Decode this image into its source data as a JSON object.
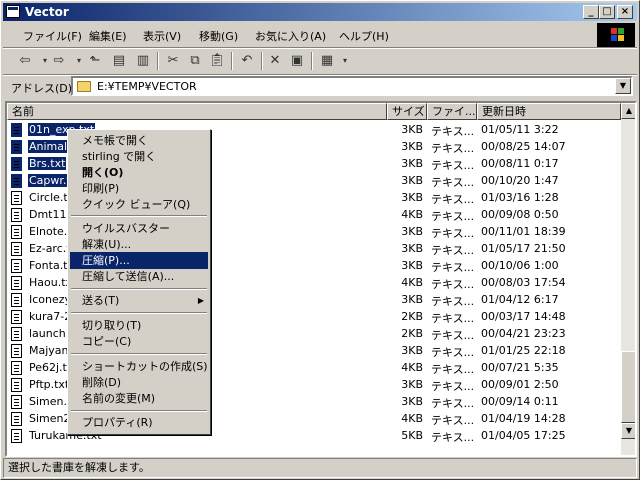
{
  "window": {
    "title": "Vector"
  },
  "menubar": [
    {
      "label": "ファイル(F)"
    },
    {
      "label": "編集(E)"
    },
    {
      "label": "表示(V)"
    },
    {
      "label": "移動(G)"
    },
    {
      "label": "お気に入り(A)"
    },
    {
      "label": "ヘルプ(H)"
    }
  ],
  "address": {
    "label": "アドレス(D)",
    "value": "E:¥TEMP¥VECTOR"
  },
  "columns": {
    "name": "名前",
    "size": "サイズ",
    "type": "ファイ...",
    "date": "更新日時"
  },
  "files": [
    {
      "name": "01n_exp.txt",
      "size": "3KB",
      "type": "テキス...",
      "date": "01/05/11 3:22",
      "selected": true
    },
    {
      "name": "Animal.txt",
      "size": "3KB",
      "type": "テキス...",
      "date": "00/08/25 14:07",
      "selected": true
    },
    {
      "name": "Brs.txt",
      "size": "3KB",
      "type": "テキス...",
      "date": "00/08/11 0:17",
      "selected": true
    },
    {
      "name": "Capwr.txt",
      "size": "3KB",
      "type": "テキス...",
      "date": "00/10/20 1:47",
      "selected": true
    },
    {
      "name": "Circle.txt",
      "size": "3KB",
      "type": "テキス...",
      "date": "01/03/16 1:28",
      "selected": false
    },
    {
      "name": "Dmt116.txt",
      "size": "4KB",
      "type": "テキス...",
      "date": "00/09/08 0:50",
      "selected": false
    },
    {
      "name": "Elnote.txt",
      "size": "3KB",
      "type": "テキス...",
      "date": "00/11/01 18:39",
      "selected": false
    },
    {
      "name": "Ez-arc.txt",
      "size": "3KB",
      "type": "テキス...",
      "date": "01/05/17 21:50",
      "selected": false
    },
    {
      "name": "Fonta.txt",
      "size": "3KB",
      "type": "テキス...",
      "date": "00/10/06 1:00",
      "selected": false
    },
    {
      "name": "Haou.txt",
      "size": "4KB",
      "type": "テキス...",
      "date": "00/08/03 17:54",
      "selected": false
    },
    {
      "name": "Iconezy.txt",
      "size": "3KB",
      "type": "テキス...",
      "date": "01/04/12 6:17",
      "selected": false
    },
    {
      "name": "kura7-2.txt",
      "size": "2KB",
      "type": "テキス...",
      "date": "00/03/17 14:48",
      "selected": false
    },
    {
      "name": "launch.txt",
      "size": "2KB",
      "type": "テキス...",
      "date": "00/04/21 23:23",
      "selected": false
    },
    {
      "name": "Majyan.txt",
      "size": "3KB",
      "type": "テキス...",
      "date": "01/01/25 22:18",
      "selected": false
    },
    {
      "name": "Pe62j.txt",
      "size": "4KB",
      "type": "テキス...",
      "date": "00/07/21 5:35",
      "selected": false
    },
    {
      "name": "Pftp.txt",
      "size": "3KB",
      "type": "テキス...",
      "date": "00/09/01 2:50",
      "selected": false
    },
    {
      "name": "Simen.txt",
      "size": "3KB",
      "type": "テキス...",
      "date": "00/09/14 0:11",
      "selected": false
    },
    {
      "name": "Simen2.txt",
      "size": "4KB",
      "type": "テキス...",
      "date": "01/04/19 14:28",
      "selected": false
    },
    {
      "name": "Turukame.txt",
      "size": "5KB",
      "type": "テキス...",
      "date": "01/04/05 17:25",
      "selected": false
    }
  ],
  "context_menu": [
    {
      "label": "メモ帳で開く"
    },
    {
      "label": "stirling で開く"
    },
    {
      "label": "開く(O)"
    },
    {
      "label": "印刷(P)"
    },
    {
      "label": "クイック ビューア(Q)"
    },
    {
      "label": "ウイルスバスター"
    },
    {
      "label": "解凍(U)..."
    },
    {
      "label": "圧縮(P)..."
    },
    {
      "label": "圧縮して送信(A)..."
    },
    {
      "label": "送る(T)"
    },
    {
      "label": "切り取り(T)"
    },
    {
      "label": "コピー(C)"
    },
    {
      "label": "ショートカットの作成(S)"
    },
    {
      "label": "削除(D)"
    },
    {
      "label": "名前の変更(M)"
    },
    {
      "label": "プロパティ(R)"
    }
  ],
  "status": {
    "text": "選択した書庫を解凍します。"
  },
  "colors": {
    "title_start": "#0a246a",
    "title_end": "#a6caf0",
    "selection": "#0a246a",
    "face": "#d4d0c8"
  }
}
